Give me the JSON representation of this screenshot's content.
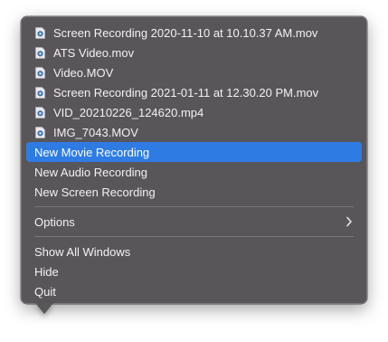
{
  "recent_files": [
    {
      "label": "Screen Recording 2020-11-10 at 10.10.37 AM.mov",
      "icon": "movie-file-icon"
    },
    {
      "label": "ATS Video.mov",
      "icon": "movie-file-icon"
    },
    {
      "label": "Video.MOV",
      "icon": "movie-file-icon"
    },
    {
      "label": "Screen Recording 2021-01-11 at 12.30.20 PM.mov",
      "icon": "movie-file-icon"
    },
    {
      "label": "VID_20210226_124620.mp4",
      "icon": "movie-file-icon"
    },
    {
      "label": "IMG_7043.MOV",
      "icon": "movie-file-icon"
    }
  ],
  "new_actions": {
    "movie": "New Movie Recording",
    "audio": "New Audio Recording",
    "screen": "New Screen Recording"
  },
  "options": {
    "label": "Options",
    "icon": "chevron-right-icon"
  },
  "window_actions": {
    "show_all": "Show All Windows",
    "hide": "Hide",
    "quit": "Quit"
  },
  "colors": {
    "menu_background": "#59565a",
    "highlight": "#2e7ce3",
    "text": "#f2f2f2"
  }
}
